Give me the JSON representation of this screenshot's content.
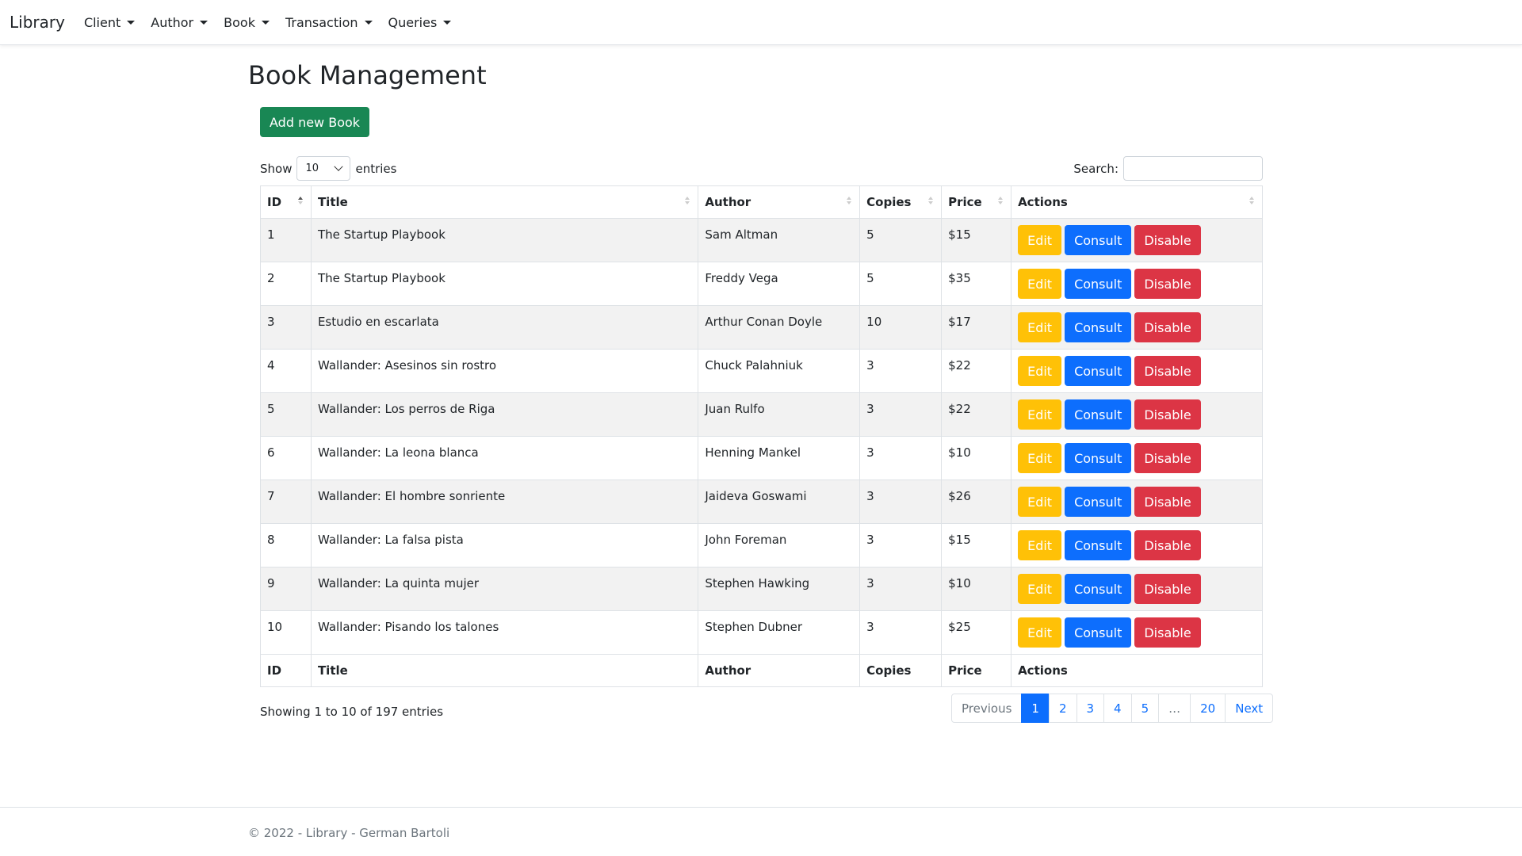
{
  "navbar": {
    "brand": "Library",
    "items": [
      {
        "label": "Client"
      },
      {
        "label": "Author"
      },
      {
        "label": "Book"
      },
      {
        "label": "Transaction"
      },
      {
        "label": "Queries"
      }
    ]
  },
  "page": {
    "title": "Book Management",
    "add_button": "Add new Book"
  },
  "controls": {
    "show_label": "Show",
    "page_size": "10",
    "entries_label": "entries",
    "search_label": "Search:",
    "search_value": ""
  },
  "table": {
    "columns": [
      "ID",
      "Title",
      "Author",
      "Copies",
      "Price",
      "Actions"
    ],
    "rows": [
      {
        "id": "1",
        "title": "The Startup Playbook",
        "author": "Sam Altman",
        "copies": "5",
        "price": "$15"
      },
      {
        "id": "2",
        "title": "The Startup Playbook",
        "author": "Freddy Vega",
        "copies": "5",
        "price": "$35"
      },
      {
        "id": "3",
        "title": "Estudio en escarlata",
        "author": "Arthur Conan Doyle",
        "copies": "10",
        "price": "$17"
      },
      {
        "id": "4",
        "title": "Wallander: Asesinos sin rostro",
        "author": "Chuck Palahniuk",
        "copies": "3",
        "price": "$22"
      },
      {
        "id": "5",
        "title": "Wallander: Los perros de Riga",
        "author": "Juan Rulfo",
        "copies": "3",
        "price": "$22"
      },
      {
        "id": "6",
        "title": "Wallander: La leona blanca",
        "author": "Henning Mankel",
        "copies": "3",
        "price": "$10"
      },
      {
        "id": "7",
        "title": "Wallander: El hombre sonriente",
        "author": "Jaideva Goswami",
        "copies": "3",
        "price": "$26"
      },
      {
        "id": "8",
        "title": "Wallander: La falsa pista",
        "author": "John Foreman",
        "copies": "3",
        "price": "$15"
      },
      {
        "id": "9",
        "title": "Wallander: La quinta mujer",
        "author": "Stephen Hawking",
        "copies": "3",
        "price": "$10"
      },
      {
        "id": "10",
        "title": "Wallander: Pisando los talones",
        "author": "Stephen Dubner",
        "copies": "3",
        "price": "$25"
      }
    ],
    "actions": {
      "edit": "Edit",
      "consult": "Consult",
      "disable": "Disable"
    }
  },
  "info": "Showing 1 to 10 of 197 entries",
  "pagination": [
    "Previous",
    "1",
    "2",
    "3",
    "4",
    "5",
    "…",
    "20",
    "Next"
  ],
  "footer": "© 2022 - Library - German Bartoli",
  "colors": {
    "success": "#198754",
    "primary": "#0d6efd",
    "warning": "#ffc107",
    "danger": "#dc3545"
  }
}
